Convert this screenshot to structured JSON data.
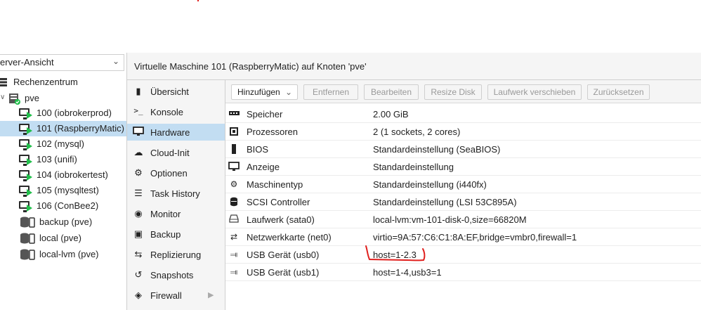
{
  "tree": {
    "view_select": "erver-Ansicht",
    "datacenter": "Rechenzentrum",
    "node": "pve",
    "items": [
      {
        "label": "100 (iobrokerprod)",
        "type": "vm",
        "running": true
      },
      {
        "label": "101 (RaspberryMatic)",
        "type": "vm",
        "running": true,
        "selected": true
      },
      {
        "label": "102 (mysql)",
        "type": "vm",
        "running": true
      },
      {
        "label": "103 (unifi)",
        "type": "vm",
        "running": true
      },
      {
        "label": "104 (iobrokertest)",
        "type": "vm",
        "running": true
      },
      {
        "label": "105 (mysqltest)",
        "type": "vm",
        "running": true
      },
      {
        "label": "106 (ConBee2)",
        "type": "vm",
        "running": true
      },
      {
        "label": "backup (pve)",
        "type": "storage"
      },
      {
        "label": "local (pve)",
        "type": "storage"
      },
      {
        "label": "local-lvm (pve)",
        "type": "storage"
      }
    ]
  },
  "header": {
    "title": "Virtuelle Maschine 101 (RaspberryMatic) auf Knoten 'pve'"
  },
  "nav": {
    "items": [
      {
        "label": "Übersicht",
        "icon": "book-icon"
      },
      {
        "label": "Konsole",
        "icon": "terminal-icon"
      },
      {
        "label": "Hardware",
        "icon": "monitor-icon",
        "selected": true
      },
      {
        "label": "Cloud-Init",
        "icon": "cloud-icon"
      },
      {
        "label": "Optionen",
        "icon": "gear-icon"
      },
      {
        "label": "Task History",
        "icon": "list-icon"
      },
      {
        "label": "Monitor",
        "icon": "eye-icon"
      },
      {
        "label": "Backup",
        "icon": "floppy-icon"
      },
      {
        "label": "Replizierung",
        "icon": "retweet-icon"
      },
      {
        "label": "Snapshots",
        "icon": "history-icon"
      },
      {
        "label": "Firewall",
        "icon": "shield-icon"
      }
    ]
  },
  "toolbar": {
    "add": "Hinzufügen",
    "remove": "Entfernen",
    "edit": "Bearbeiten",
    "resize": "Resize Disk",
    "move": "Laufwerk verschieben",
    "revert": "Zurücksetzen"
  },
  "hardware": {
    "rows": [
      {
        "key": "Speicher",
        "value": "2.00 GiB",
        "icon": "memory-icon"
      },
      {
        "key": "Prozessoren",
        "value": "2 (1 sockets, 2 cores)",
        "icon": "cpu-icon"
      },
      {
        "key": "BIOS",
        "value": "Standardeinstellung (SeaBIOS)",
        "icon": "microchip-icon"
      },
      {
        "key": "Anzeige",
        "value": "Standardeinstellung",
        "icon": "desktop-icon"
      },
      {
        "key": "Maschinentyp",
        "value": "Standardeinstellung (i440fx)",
        "icon": "cogs-icon"
      },
      {
        "key": "SCSI Controller",
        "value": "Standardeinstellung (LSI 53C895A)",
        "icon": "database-icon"
      },
      {
        "key": "Laufwerk (sata0)",
        "value": "local-lvm:vm-101-disk-0,size=66820M",
        "icon": "hdd-icon"
      },
      {
        "key": "Netzwerkkarte (net0)",
        "value": "virtio=9A:57:C6:C1:8A:EF,bridge=vmbr0,firewall=1",
        "icon": "exchange-icon"
      },
      {
        "key": "USB Gerät (usb0)",
        "value": "host=1-2.3",
        "icon": "usb-icon"
      },
      {
        "key": "USB Gerät (usb1)",
        "value": "host=1-4,usb3=1",
        "icon": "usb-icon"
      }
    ]
  },
  "colors": {
    "selection": "#c2ddf2",
    "running": "#21bf4b",
    "annotation": "#e0201e"
  }
}
